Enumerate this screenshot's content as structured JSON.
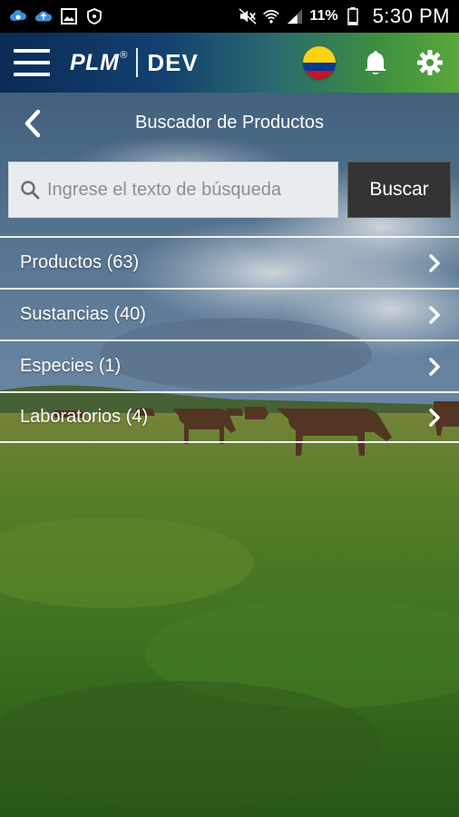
{
  "status_bar": {
    "left_icons": [
      "cloud-sync-icon",
      "cloud-upload-icon",
      "image-icon",
      "shield-icon"
    ],
    "right_icons": [
      "mute-icon",
      "wifi-icon",
      "signal-icon",
      "battery-icon"
    ],
    "battery_percent": "11%",
    "time": "5:30 PM"
  },
  "app_bar": {
    "brand": "PLM",
    "brand_mark": "®",
    "env": "DEV",
    "country_flag": "colombia-flag",
    "icons": [
      "menu-icon",
      "bell-icon",
      "gear-icon"
    ],
    "accent_colors": {
      "start": "#0a2b56",
      "end": "#58a83a"
    }
  },
  "page": {
    "title": "Buscador de Productos"
  },
  "search": {
    "placeholder": "Ingrese el texto de búsqueda",
    "value": "",
    "button_label": "Buscar"
  },
  "results": [
    {
      "label": "Productos (63)"
    },
    {
      "label": "Sustancias (40)"
    },
    {
      "label": "Especies (1)"
    },
    {
      "label": "Laboratorios (4)"
    }
  ]
}
